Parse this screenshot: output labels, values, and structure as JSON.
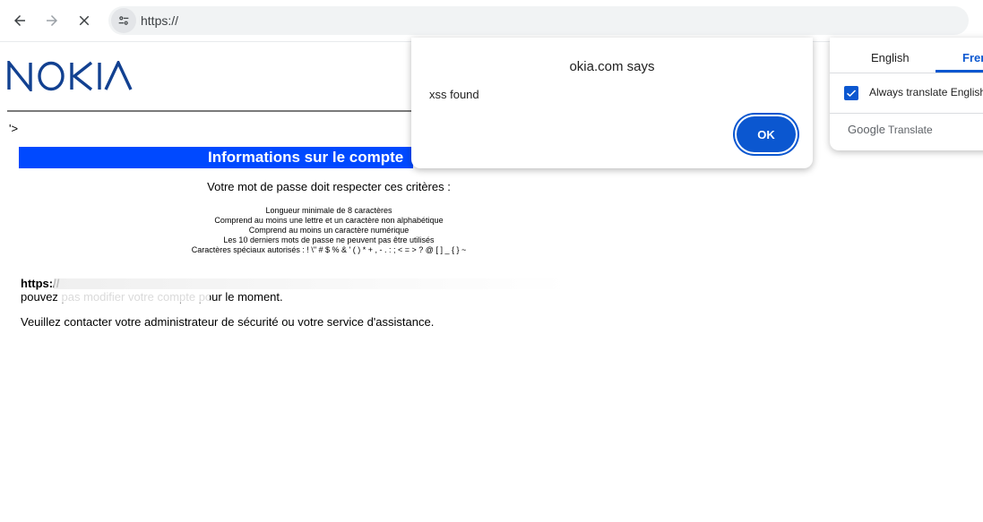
{
  "browser": {
    "url_prefix": "https://",
    "back_icon": "arrow-left-icon",
    "forward_icon": "arrow-right-icon",
    "stop_icon": "close-icon",
    "site_info_icon": "tune-icon"
  },
  "page": {
    "stray_text": "'>",
    "banner_title": "Informations sur le compte",
    "criteria_title": "Votre mot de passe doit respecter ces critères :",
    "criteria": [
      "Longueur minimale de 8 caractères",
      "Comprend au moins une lettre et un caractère non alphabétique",
      "Comprend au moins un caractère numérique",
      "Les 10 derniers mots de passe ne peuvent pas être utilisés",
      "Caractères spéciaux autorisés : ! \\\" # $ % & ' ( ) * + , - . : ; < = > ? @ [ ] _ { } ~"
    ],
    "url_line": "https://",
    "message1": "pouvez pas modifier votre compte pour le moment.",
    "message2": "Veuillez contacter votre administrateur de sécurité ou votre service d'assistance.",
    "brand_color": "#0049ff"
  },
  "dialog": {
    "title": "okia.com says",
    "message": "xss found",
    "ok_label": "OK",
    "accent": "#0b57d0"
  },
  "translate": {
    "tab_source": "English",
    "tab_target": "Fren",
    "always_translate": "Always translate English",
    "brand_google": "Google",
    "brand_translate": "Translate"
  }
}
